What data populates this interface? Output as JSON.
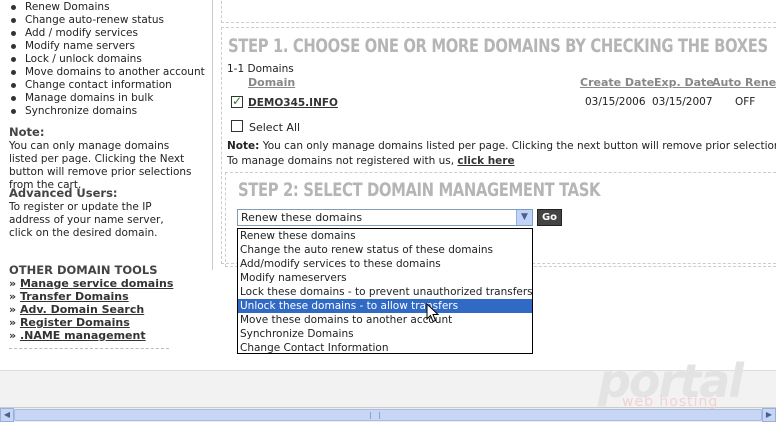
{
  "sidebar": {
    "menu": [
      "Renew Domains",
      "Change auto-renew status",
      "Add / modify services",
      "Modify name servers",
      "Lock / unlock domains",
      "Move domains to another account",
      "Change contact information",
      "Manage domains in bulk",
      "Synchronize domains"
    ],
    "note_label": "Note:",
    "note_text": "You can only manage domains listed per page. Clicking the Next button will remove prior selections from the cart.",
    "advanced_label": "Advanced Users:",
    "advanced_text": "To register or update the IP address of your name server, click on the desired domain.",
    "tools_heading": "OTHER DOMAIN TOOLS",
    "tools": [
      "Manage service domains",
      "Transfer Domains",
      "Adv. Domain Search",
      "Register Domains",
      ".NAME management"
    ]
  },
  "step1": {
    "title": "STEP 1. CHOOSE ONE OR MORE DOMAINS BY CHECKING THE BOXES",
    "count": "1-1 Domains",
    "columns": [
      "Domain",
      "Create Date",
      "Exp. Date",
      "Auto Renew"
    ],
    "row": {
      "domain": "DEMO345.INFO",
      "create_date": "03/15/2006",
      "exp_date": "03/15/2007",
      "auto_renew": "OFF",
      "checked": true
    },
    "select_all": "Select All",
    "note_label": "Note:",
    "note_text": "You can only manage domains listed per page. Clicking the next button will remove prior selections",
    "unregistered_text": "To manage domains not registered with us,",
    "click_here": "click here"
  },
  "step2": {
    "title": "STEP 2: SELECT DOMAIN MANAGEMENT TASK",
    "selected_value": "Renew these domains",
    "go_label": "Go",
    "options": [
      "Renew these domains",
      "Change the auto renew status of these domains",
      "Add/modify services to these domains",
      "Modify nameservers",
      "Lock these domains - to prevent unauthorized transfers",
      "Unlock these domains - to allow transfers",
      "Move these domains to another account",
      "Synchronize Domains",
      "Change Contact Information"
    ],
    "highlighted_index": 5
  },
  "watermark": {
    "logo": "portal",
    "sub": "web hosting"
  },
  "colors": {
    "highlight": "#316ac5",
    "step_title": "#b5b5b5"
  }
}
